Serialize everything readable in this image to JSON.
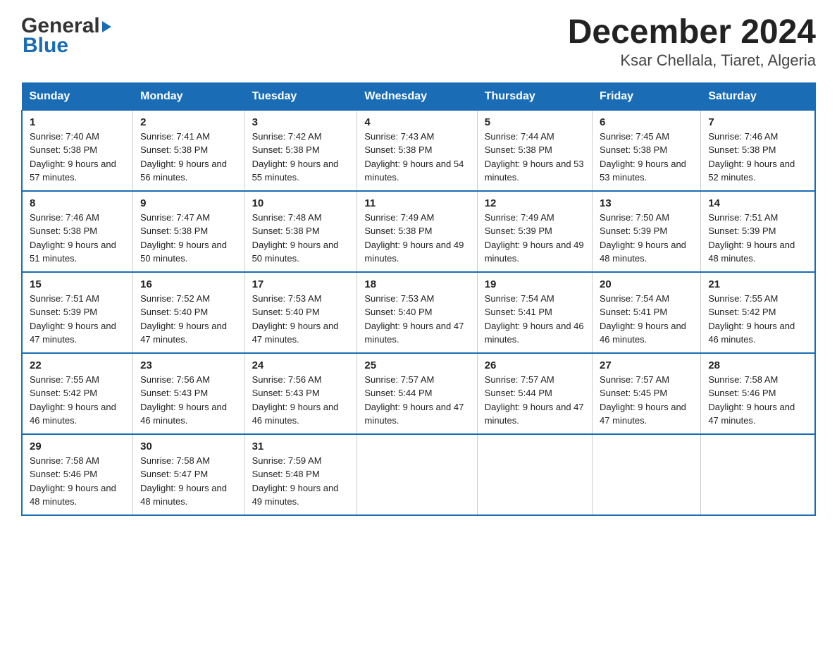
{
  "header": {
    "title": "December 2024",
    "subtitle": "Ksar Chellala, Tiaret, Algeria",
    "logo_general": "General",
    "logo_blue": "Blue"
  },
  "days_of_week": [
    "Sunday",
    "Monday",
    "Tuesday",
    "Wednesday",
    "Thursday",
    "Friday",
    "Saturday"
  ],
  "weeks": [
    [
      {
        "date": "1",
        "sunrise": "7:40 AM",
        "sunset": "5:38 PM",
        "daylight": "9 hours and 57 minutes."
      },
      {
        "date": "2",
        "sunrise": "7:41 AM",
        "sunset": "5:38 PM",
        "daylight": "9 hours and 56 minutes."
      },
      {
        "date": "3",
        "sunrise": "7:42 AM",
        "sunset": "5:38 PM",
        "daylight": "9 hours and 55 minutes."
      },
      {
        "date": "4",
        "sunrise": "7:43 AM",
        "sunset": "5:38 PM",
        "daylight": "9 hours and 54 minutes."
      },
      {
        "date": "5",
        "sunrise": "7:44 AM",
        "sunset": "5:38 PM",
        "daylight": "9 hours and 53 minutes."
      },
      {
        "date": "6",
        "sunrise": "7:45 AM",
        "sunset": "5:38 PM",
        "daylight": "9 hours and 53 minutes."
      },
      {
        "date": "7",
        "sunrise": "7:46 AM",
        "sunset": "5:38 PM",
        "daylight": "9 hours and 52 minutes."
      }
    ],
    [
      {
        "date": "8",
        "sunrise": "7:46 AM",
        "sunset": "5:38 PM",
        "daylight": "9 hours and 51 minutes."
      },
      {
        "date": "9",
        "sunrise": "7:47 AM",
        "sunset": "5:38 PM",
        "daylight": "9 hours and 50 minutes."
      },
      {
        "date": "10",
        "sunrise": "7:48 AM",
        "sunset": "5:38 PM",
        "daylight": "9 hours and 50 minutes."
      },
      {
        "date": "11",
        "sunrise": "7:49 AM",
        "sunset": "5:38 PM",
        "daylight": "9 hours and 49 minutes."
      },
      {
        "date": "12",
        "sunrise": "7:49 AM",
        "sunset": "5:39 PM",
        "daylight": "9 hours and 49 minutes."
      },
      {
        "date": "13",
        "sunrise": "7:50 AM",
        "sunset": "5:39 PM",
        "daylight": "9 hours and 48 minutes."
      },
      {
        "date": "14",
        "sunrise": "7:51 AM",
        "sunset": "5:39 PM",
        "daylight": "9 hours and 48 minutes."
      }
    ],
    [
      {
        "date": "15",
        "sunrise": "7:51 AM",
        "sunset": "5:39 PM",
        "daylight": "9 hours and 47 minutes."
      },
      {
        "date": "16",
        "sunrise": "7:52 AM",
        "sunset": "5:40 PM",
        "daylight": "9 hours and 47 minutes."
      },
      {
        "date": "17",
        "sunrise": "7:53 AM",
        "sunset": "5:40 PM",
        "daylight": "9 hours and 47 minutes."
      },
      {
        "date": "18",
        "sunrise": "7:53 AM",
        "sunset": "5:40 PM",
        "daylight": "9 hours and 47 minutes."
      },
      {
        "date": "19",
        "sunrise": "7:54 AM",
        "sunset": "5:41 PM",
        "daylight": "9 hours and 46 minutes."
      },
      {
        "date": "20",
        "sunrise": "7:54 AM",
        "sunset": "5:41 PM",
        "daylight": "9 hours and 46 minutes."
      },
      {
        "date": "21",
        "sunrise": "7:55 AM",
        "sunset": "5:42 PM",
        "daylight": "9 hours and 46 minutes."
      }
    ],
    [
      {
        "date": "22",
        "sunrise": "7:55 AM",
        "sunset": "5:42 PM",
        "daylight": "9 hours and 46 minutes."
      },
      {
        "date": "23",
        "sunrise": "7:56 AM",
        "sunset": "5:43 PM",
        "daylight": "9 hours and 46 minutes."
      },
      {
        "date": "24",
        "sunrise": "7:56 AM",
        "sunset": "5:43 PM",
        "daylight": "9 hours and 46 minutes."
      },
      {
        "date": "25",
        "sunrise": "7:57 AM",
        "sunset": "5:44 PM",
        "daylight": "9 hours and 47 minutes."
      },
      {
        "date": "26",
        "sunrise": "7:57 AM",
        "sunset": "5:44 PM",
        "daylight": "9 hours and 47 minutes."
      },
      {
        "date": "27",
        "sunrise": "7:57 AM",
        "sunset": "5:45 PM",
        "daylight": "9 hours and 47 minutes."
      },
      {
        "date": "28",
        "sunrise": "7:58 AM",
        "sunset": "5:46 PM",
        "daylight": "9 hours and 47 minutes."
      }
    ],
    [
      {
        "date": "29",
        "sunrise": "7:58 AM",
        "sunset": "5:46 PM",
        "daylight": "9 hours and 48 minutes."
      },
      {
        "date": "30",
        "sunrise": "7:58 AM",
        "sunset": "5:47 PM",
        "daylight": "9 hours and 48 minutes."
      },
      {
        "date": "31",
        "sunrise": "7:59 AM",
        "sunset": "5:48 PM",
        "daylight": "9 hours and 49 minutes."
      },
      {
        "date": "",
        "sunrise": "",
        "sunset": "",
        "daylight": ""
      },
      {
        "date": "",
        "sunrise": "",
        "sunset": "",
        "daylight": ""
      },
      {
        "date": "",
        "sunrise": "",
        "sunset": "",
        "daylight": ""
      },
      {
        "date": "",
        "sunrise": "",
        "sunset": "",
        "daylight": ""
      }
    ]
  ]
}
